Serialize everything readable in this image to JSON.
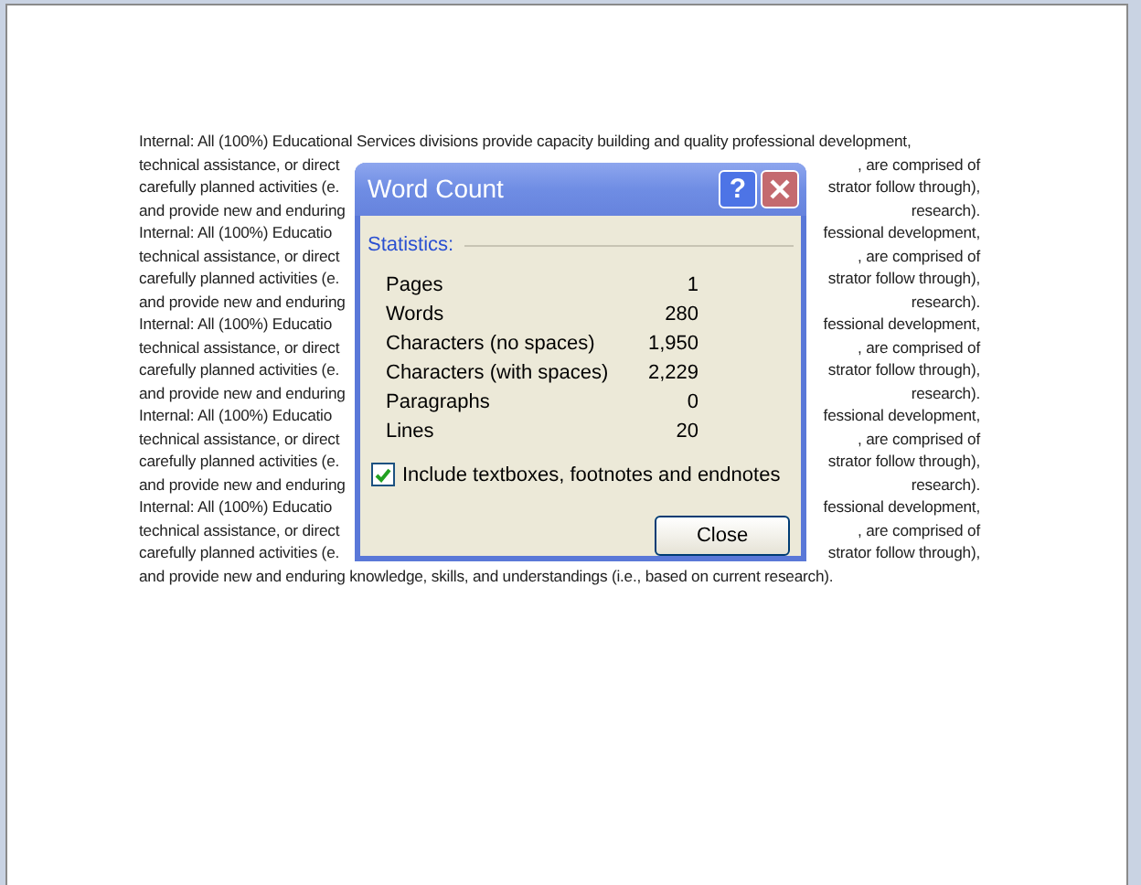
{
  "document": {
    "lines": [
      {
        "kind": "full",
        "text": "Internal: All (100%) Educational Services divisions provide capacity building and quality professional development,"
      },
      {
        "kind": "split",
        "left": "technical assistance, or direct",
        "right": ", are comprised of"
      },
      {
        "kind": "split",
        "left": "carefully planned activities (e.",
        "right": "strator follow through),"
      },
      {
        "kind": "split",
        "left": "and provide new and enduring",
        "right": "research)."
      },
      {
        "kind": "split",
        "left": "Internal: All (100%) Educatio",
        "right": "fessional development,"
      },
      {
        "kind": "split",
        "left": "technical assistance, or direct",
        "right": ", are comprised of"
      },
      {
        "kind": "split",
        "left": "carefully planned activities (e.",
        "right": "strator follow through),"
      },
      {
        "kind": "split",
        "left": "and provide new and enduring",
        "right": "research)."
      },
      {
        "kind": "split",
        "left": "Internal: All (100%) Educatio",
        "right": "fessional development,"
      },
      {
        "kind": "split",
        "left": "technical assistance, or direct",
        "right": ", are comprised of"
      },
      {
        "kind": "split",
        "left": "carefully planned activities (e.",
        "right": "strator follow through),"
      },
      {
        "kind": "split",
        "left": "and provide new and enduring",
        "right": "research)."
      },
      {
        "kind": "split",
        "left": "Internal: All (100%) Educatio",
        "right": "fessional development,"
      },
      {
        "kind": "split",
        "left": "technical assistance, or direct",
        "right": ", are comprised of"
      },
      {
        "kind": "split",
        "left": "carefully planned activities (e.",
        "right": "strator follow through),"
      },
      {
        "kind": "split",
        "left": "and provide new and enduring",
        "right": "research)."
      },
      {
        "kind": "split",
        "left": "Internal: All (100%) Educatio",
        "right": "fessional development,"
      },
      {
        "kind": "split",
        "left": "technical assistance, or direct",
        "right": ", are comprised of"
      },
      {
        "kind": "split",
        "left": "carefully planned activities (e.",
        "right": "strator follow through),"
      },
      {
        "kind": "full",
        "text": "and provide new and enduring knowledge, skills, and understandings (i.e., based on current research)."
      }
    ]
  },
  "dialog": {
    "title": "Word Count",
    "help_button": "?",
    "section": "Statistics:",
    "stats": [
      {
        "label": "Pages",
        "value": "1"
      },
      {
        "label": "Words",
        "value": "280"
      },
      {
        "label": "Characters (no spaces)",
        "value": "1,950"
      },
      {
        "label": "Characters (with spaces)",
        "value": "2,229"
      },
      {
        "label": "Paragraphs",
        "value": "0"
      },
      {
        "label": "Lines",
        "value": "20"
      }
    ],
    "checkbox": {
      "label": "Include textboxes, footnotes and endnotes",
      "checked": true
    },
    "button": "Close"
  }
}
